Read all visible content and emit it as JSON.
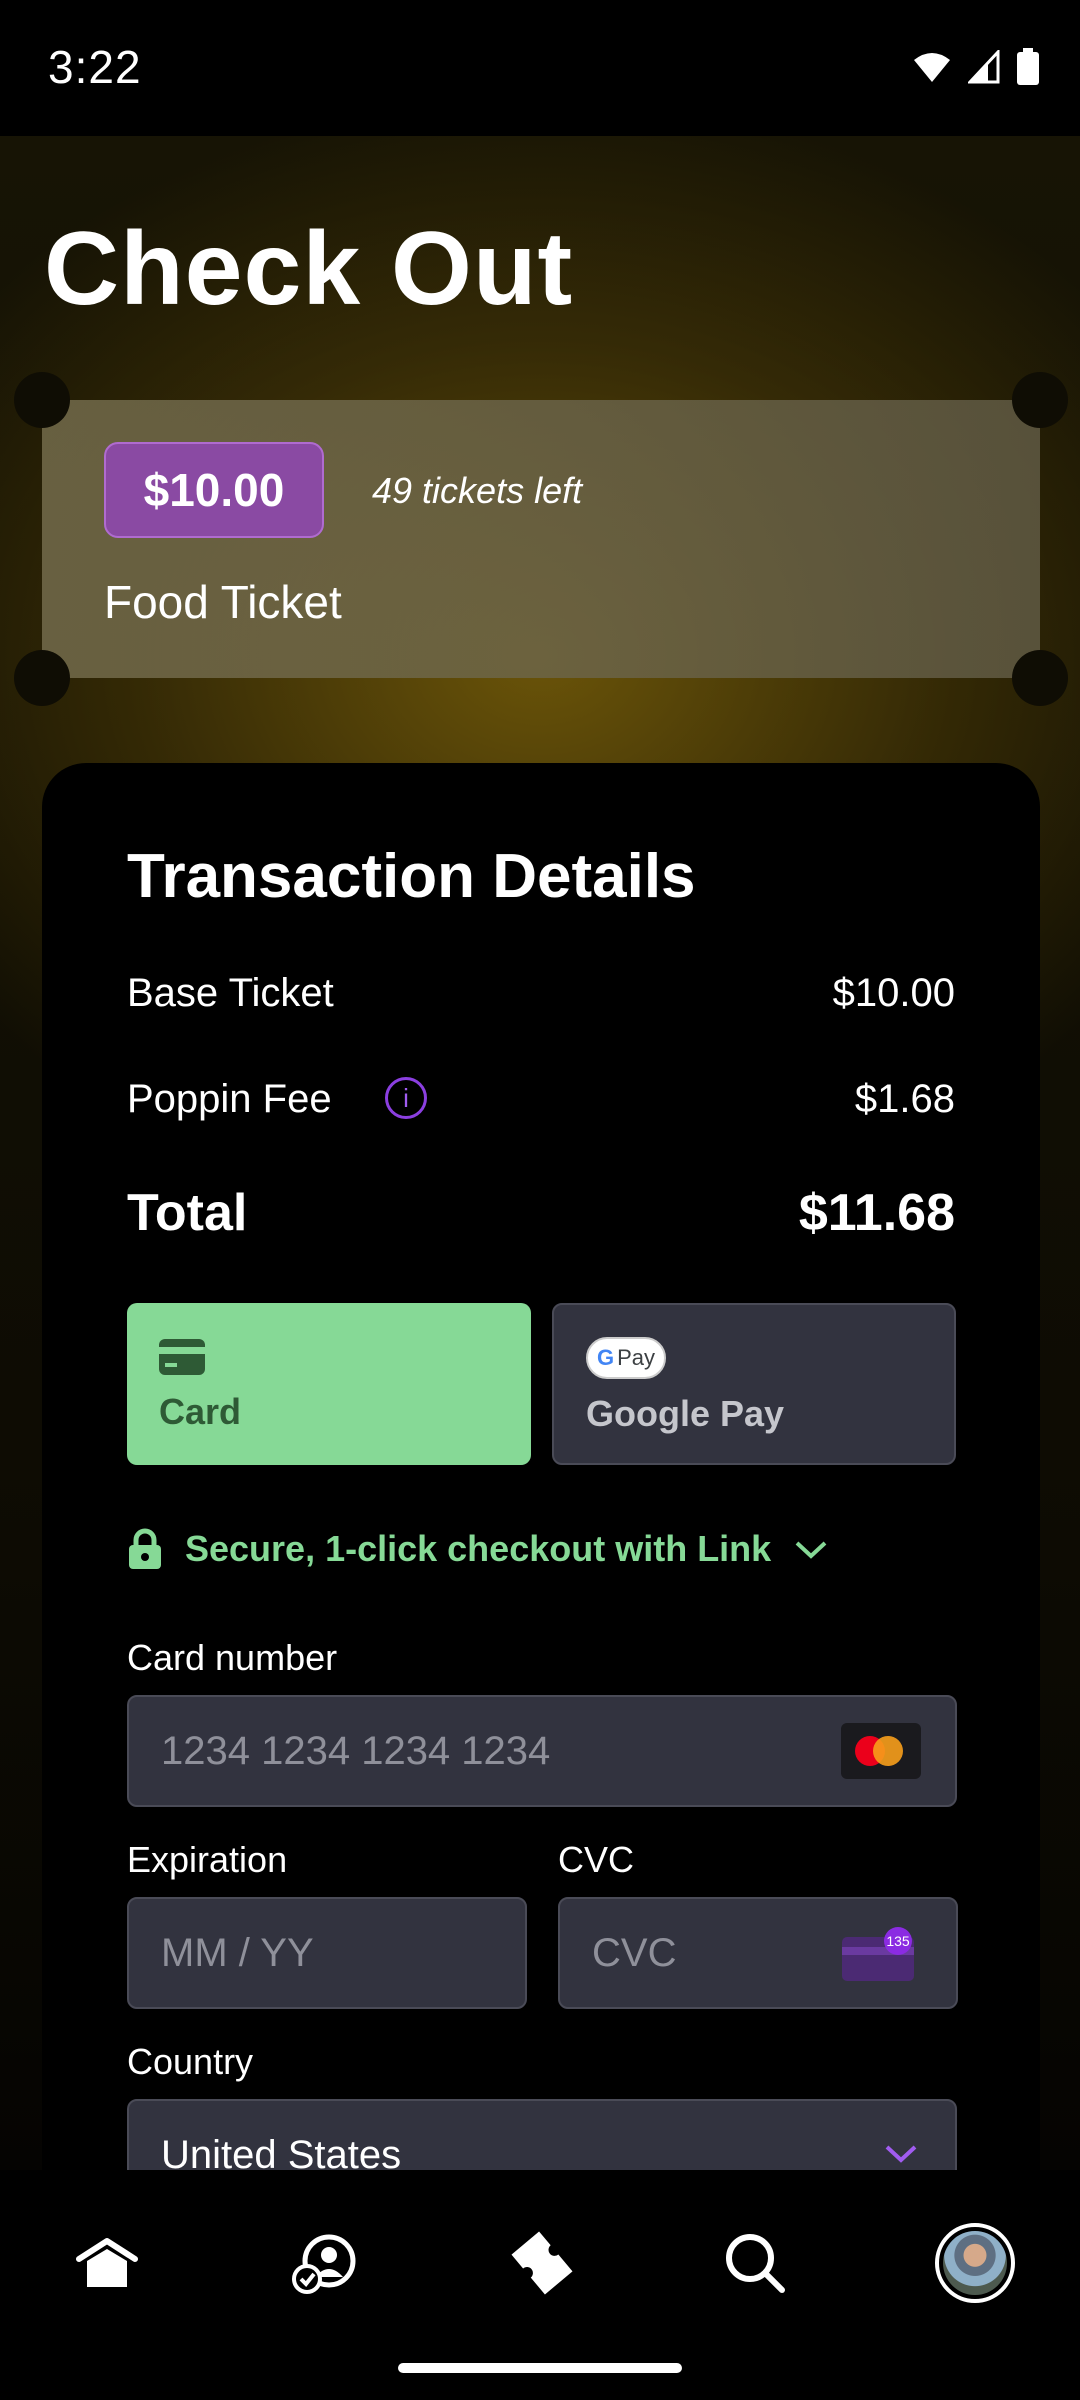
{
  "status_bar": {
    "time": "3:22"
  },
  "page": {
    "title": "Check Out"
  },
  "ticket": {
    "price": "$10.00",
    "availability": "49 tickets left",
    "name": "Food Ticket"
  },
  "transaction": {
    "title": "Transaction Details",
    "base_label": "Base Ticket",
    "base_value": "$10.00",
    "fee_label": "Poppin Fee",
    "fee_value": "$1.68",
    "total_label": "Total",
    "total_value": "$11.68"
  },
  "payment": {
    "card_label": "Card",
    "gpay_label": "Google Pay",
    "gpay_pill_text": "Pay",
    "link_text": "Secure, 1-click checkout with Link",
    "card_number_label": "Card number",
    "card_number_placeholder": "1234 1234 1234 1234",
    "expiration_label": "Expiration",
    "expiration_placeholder": "MM / YY",
    "cvc_label": "CVC",
    "cvc_placeholder": "CVC",
    "cvc_badge": "135",
    "country_label": "Country",
    "country_value": "United States"
  },
  "colors": {
    "accent_green": "#86d996",
    "accent_purple": "#8a4aa3",
    "field_bg": "#32333f"
  },
  "nav": {
    "icons": [
      "home-icon",
      "community-icon",
      "ticket-icon",
      "search-icon",
      "profile-avatar"
    ]
  }
}
